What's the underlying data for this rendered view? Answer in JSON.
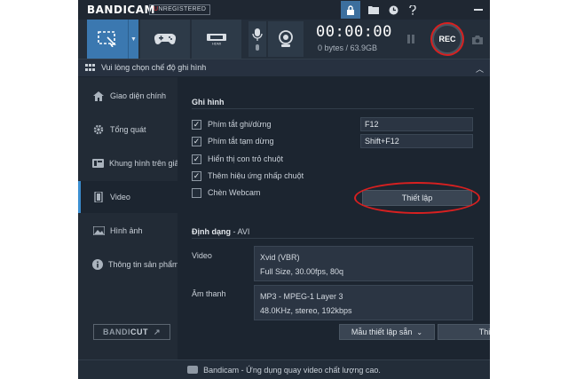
{
  "app": {
    "logo": "BANDICAM",
    "badge_first": "U",
    "badge_rest": "NREGISTERED"
  },
  "toolbar": {
    "icons": [
      "lock-icon",
      "folder-icon",
      "clock-icon",
      "help-icon",
      "minimize-icon"
    ],
    "accent": "#3b78b0"
  },
  "recorder": {
    "timer": "00:00:00",
    "size": "0 bytes / 63.9GB",
    "rec_label": "REC",
    "rec_ring_color": "#d82020",
    "modes": [
      "screen-rectangle-icon",
      "gamepad-icon",
      "hdmi-icon"
    ]
  },
  "mode_header": {
    "label": "Vui lòng chọn chế độ ghi hình"
  },
  "sidebar": {
    "items": [
      {
        "label": "Giao diện chính",
        "icon": "home-icon"
      },
      {
        "label": "Tổng quát",
        "icon": "gear-icon"
      },
      {
        "label": "Khung hình trên giây",
        "icon": "fps-icon"
      },
      {
        "label": "Video",
        "icon": "video-icon"
      },
      {
        "label": "Hình ảnh",
        "icon": "image-icon"
      },
      {
        "label": "Thông tin sản phẩm",
        "icon": "info-icon"
      }
    ],
    "active": "Video",
    "bandicut_a": "BANDI",
    "bandicut_b": "CUT",
    "bandicut_arrow": "↗"
  },
  "record": {
    "title": "Ghi hình",
    "options": [
      {
        "label": "Phím tắt ghi/dừng",
        "checked": true
      },
      {
        "label": "Phím tắt tạm dừng",
        "checked": true
      },
      {
        "label": "Hiển thị con trỏ chuột",
        "checked": true
      },
      {
        "label": "Thêm hiệu ứng nhấp chuột",
        "checked": true
      },
      {
        "label": "Chèn Webcam",
        "checked": false
      }
    ],
    "hotkey_record": "F12",
    "hotkey_pause": "Shift+F12",
    "setup_label": "Thiết lập"
  },
  "format": {
    "title": "Định dạng",
    "subtitle": " - AVI",
    "video_label": "Video",
    "video_codec": "Xvid (VBR)",
    "video_detail": "Full Size, 30.00fps, 80q",
    "audio_label": "Âm thanh",
    "audio_codec": "MP3 - MPEG-1 Layer 3",
    "audio_detail": "48.0KHz, stereo, 192kbps",
    "preset_label": "Mẫu thiết lập sẵn",
    "settings_label": "Thiết lập"
  },
  "status": {
    "text": "Bandicam - Ứng dụng quay video chất lượng cao."
  }
}
